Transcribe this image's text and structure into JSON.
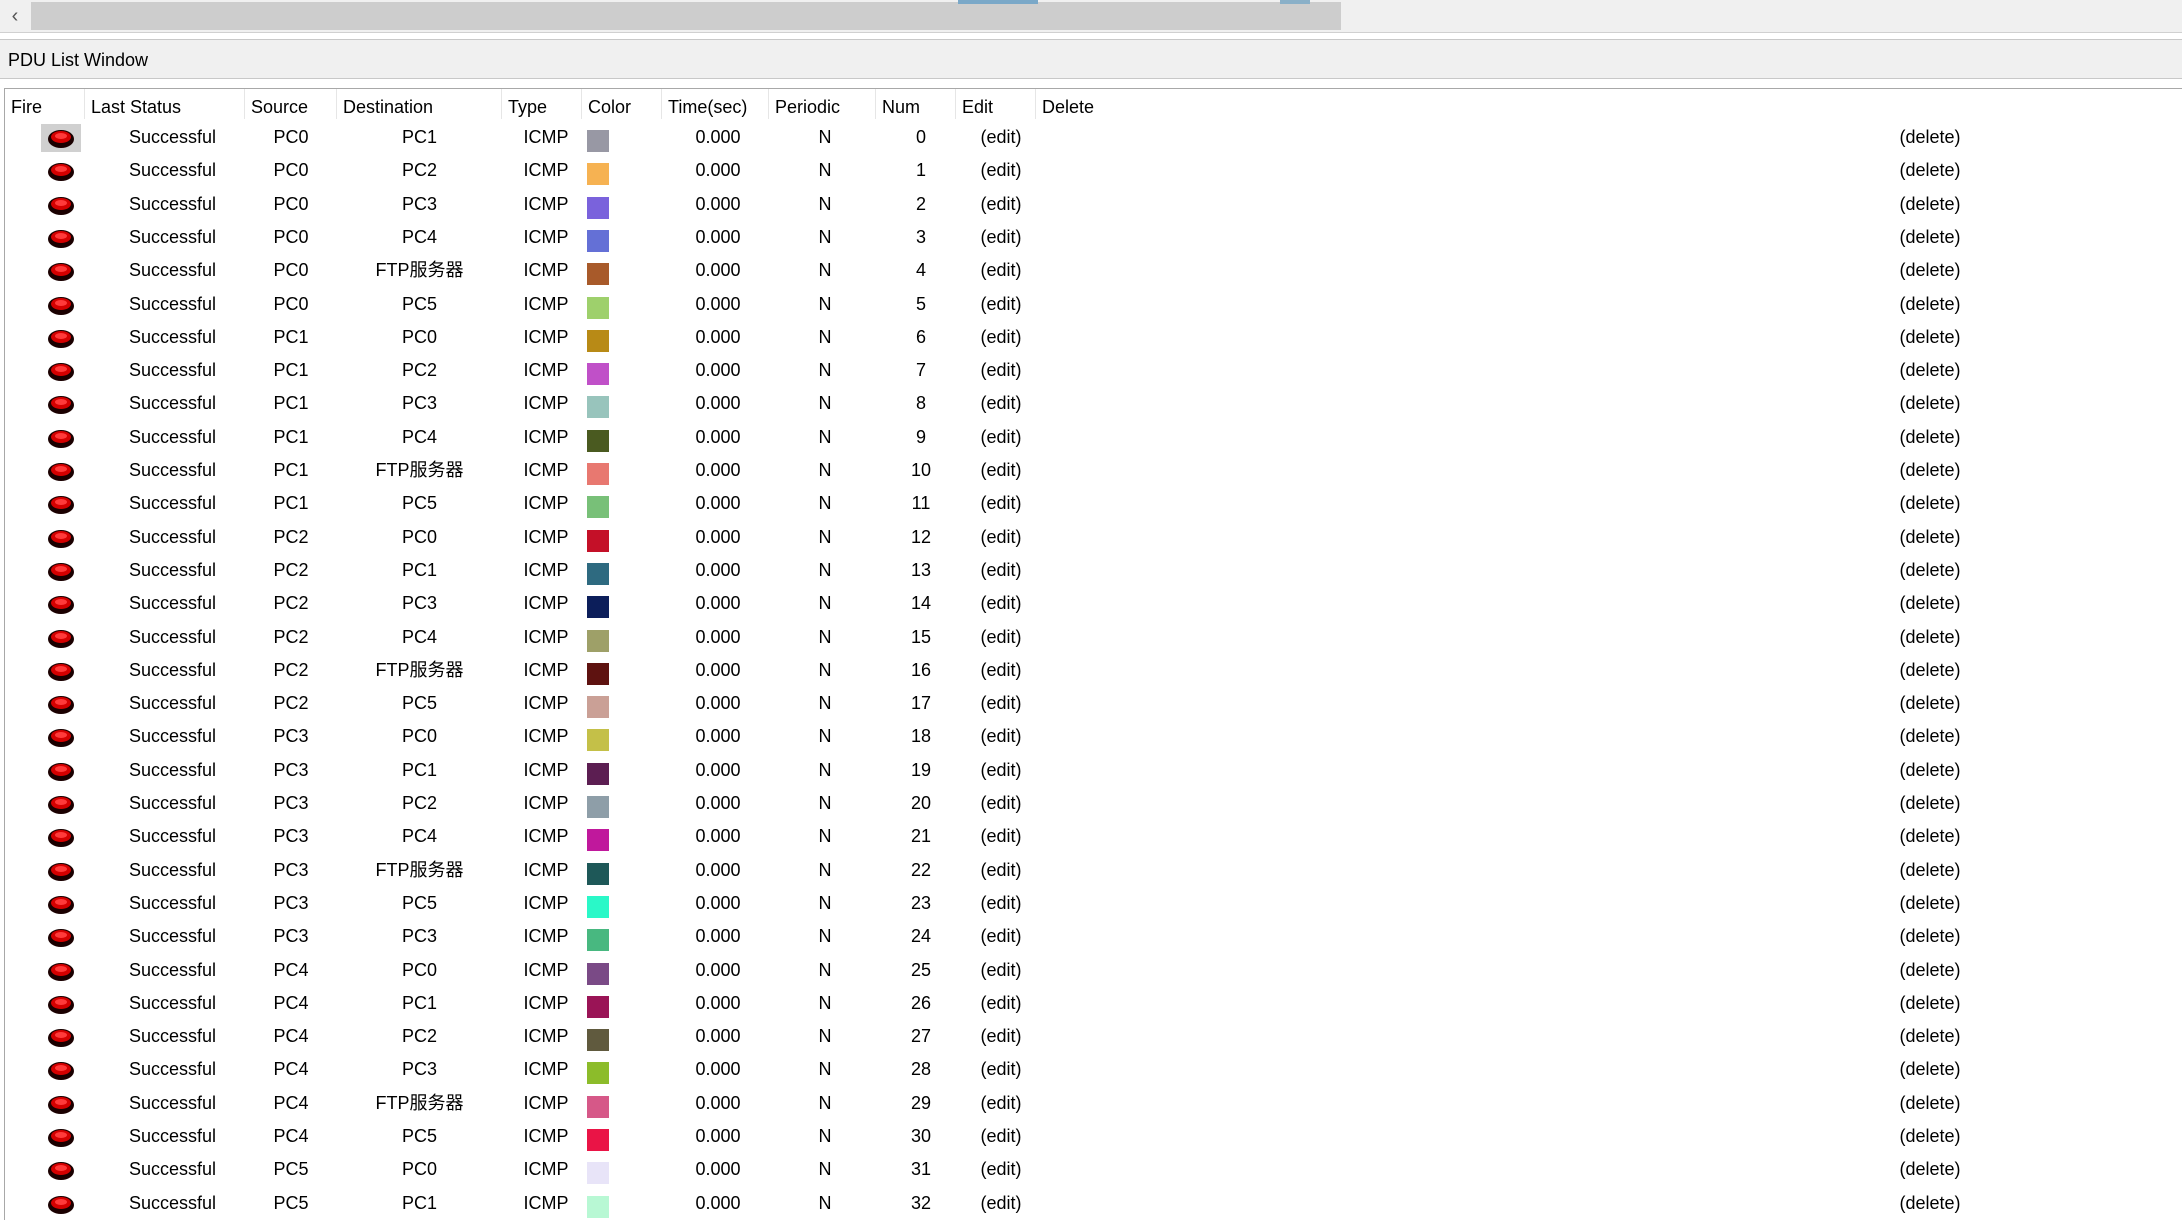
{
  "scrollbar": {
    "left_arrow": "‹"
  },
  "window": {
    "title": "PDU List Window"
  },
  "columns": [
    "Fire",
    "Last Status",
    "Source",
    "Destination",
    "Type",
    "Color",
    "Time(sec)",
    "Periodic",
    "Num",
    "Edit",
    "Delete"
  ],
  "icons": {
    "fire": "fire-ball-icon"
  },
  "rows": [
    {
      "status": "Successful",
      "source": "PC0",
      "destination": "PC1",
      "type": "ICMP",
      "color": "#9898a4",
      "time": "0.000",
      "periodic": "N",
      "num": "0",
      "edit": "(edit)",
      "delete": "(delete)"
    },
    {
      "status": "Successful",
      "source": "PC0",
      "destination": "PC2",
      "type": "ICMP",
      "color": "#f6b252",
      "time": "0.000",
      "periodic": "N",
      "num": "1",
      "edit": "(edit)",
      "delete": "(delete)"
    },
    {
      "status": "Successful",
      "source": "PC0",
      "destination": "PC3",
      "type": "ICMP",
      "color": "#7a62dc",
      "time": "0.000",
      "periodic": "N",
      "num": "2",
      "edit": "(edit)",
      "delete": "(delete)"
    },
    {
      "status": "Successful",
      "source": "PC0",
      "destination": "PC4",
      "type": "ICMP",
      "color": "#6470d6",
      "time": "0.000",
      "periodic": "N",
      "num": "3",
      "edit": "(edit)",
      "delete": "(delete)"
    },
    {
      "status": "Successful",
      "source": "PC0",
      "destination": "FTP服务器",
      "type": "ICMP",
      "color": "#a85a2a",
      "time": "0.000",
      "periodic": "N",
      "num": "4",
      "edit": "(edit)",
      "delete": "(delete)"
    },
    {
      "status": "Successful",
      "source": "PC0",
      "destination": "PC5",
      "type": "ICMP",
      "color": "#9ed06c",
      "time": "0.000",
      "periodic": "N",
      "num": "5",
      "edit": "(edit)",
      "delete": "(delete)"
    },
    {
      "status": "Successful",
      "source": "PC1",
      "destination": "PC0",
      "type": "ICMP",
      "color": "#b88a16",
      "time": "0.000",
      "periodic": "N",
      "num": "6",
      "edit": "(edit)",
      "delete": "(delete)"
    },
    {
      "status": "Successful",
      "source": "PC1",
      "destination": "PC2",
      "type": "ICMP",
      "color": "#c050c8",
      "time": "0.000",
      "periodic": "N",
      "num": "7",
      "edit": "(edit)",
      "delete": "(delete)"
    },
    {
      "status": "Successful",
      "source": "PC1",
      "destination": "PC3",
      "type": "ICMP",
      "color": "#98c4bc",
      "time": "0.000",
      "periodic": "N",
      "num": "8",
      "edit": "(edit)",
      "delete": "(delete)"
    },
    {
      "status": "Successful",
      "source": "PC1",
      "destination": "PC4",
      "type": "ICMP",
      "color": "#4a5a20",
      "time": "0.000",
      "periodic": "N",
      "num": "9",
      "edit": "(edit)",
      "delete": "(delete)"
    },
    {
      "status": "Successful",
      "source": "PC1",
      "destination": "FTP服务器",
      "type": "ICMP",
      "color": "#e87870",
      "time": "0.000",
      "periodic": "N",
      "num": "10",
      "edit": "(edit)",
      "delete": "(delete)"
    },
    {
      "status": "Successful",
      "source": "PC1",
      "destination": "PC5",
      "type": "ICMP",
      "color": "#78c078",
      "time": "0.000",
      "periodic": "N",
      "num": "11",
      "edit": "(edit)",
      "delete": "(delete)"
    },
    {
      "status": "Successful",
      "source": "PC2",
      "destination": "PC0",
      "type": "ICMP",
      "color": "#c41028",
      "time": "0.000",
      "periodic": "N",
      "num": "12",
      "edit": "(edit)",
      "delete": "(delete)"
    },
    {
      "status": "Successful",
      "source": "PC2",
      "destination": "PC1",
      "type": "ICMP",
      "color": "#2e6a80",
      "time": "0.000",
      "periodic": "N",
      "num": "13",
      "edit": "(edit)",
      "delete": "(delete)"
    },
    {
      "status": "Successful",
      "source": "PC2",
      "destination": "PC3",
      "type": "ICMP",
      "color": "#0c1e5a",
      "time": "0.000",
      "periodic": "N",
      "num": "14",
      "edit": "(edit)",
      "delete": "(delete)"
    },
    {
      "status": "Successful",
      "source": "PC2",
      "destination": "PC4",
      "type": "ICMP",
      "color": "#9ea068",
      "time": "0.000",
      "periodic": "N",
      "num": "15",
      "edit": "(edit)",
      "delete": "(delete)"
    },
    {
      "status": "Successful",
      "source": "PC2",
      "destination": "FTP服务器",
      "type": "ICMP",
      "color": "#5e1210",
      "time": "0.000",
      "periodic": "N",
      "num": "16",
      "edit": "(edit)",
      "delete": "(delete)"
    },
    {
      "status": "Successful",
      "source": "PC2",
      "destination": "PC5",
      "type": "ICMP",
      "color": "#caa096",
      "time": "0.000",
      "periodic": "N",
      "num": "17",
      "edit": "(edit)",
      "delete": "(delete)"
    },
    {
      "status": "Successful",
      "source": "PC3",
      "destination": "PC0",
      "type": "ICMP",
      "color": "#c4c048",
      "time": "0.000",
      "periodic": "N",
      "num": "18",
      "edit": "(edit)",
      "delete": "(delete)"
    },
    {
      "status": "Successful",
      "source": "PC3",
      "destination": "PC1",
      "type": "ICMP",
      "color": "#5c1e52",
      "time": "0.000",
      "periodic": "N",
      "num": "19",
      "edit": "(edit)",
      "delete": "(delete)"
    },
    {
      "status": "Successful",
      "source": "PC3",
      "destination": "PC2",
      "type": "ICMP",
      "color": "#8e9ea8",
      "time": "0.000",
      "periodic": "N",
      "num": "20",
      "edit": "(edit)",
      "delete": "(delete)"
    },
    {
      "status": "Successful",
      "source": "PC3",
      "destination": "PC4",
      "type": "ICMP",
      "color": "#c0189c",
      "time": "0.000",
      "periodic": "N",
      "num": "21",
      "edit": "(edit)",
      "delete": "(delete)"
    },
    {
      "status": "Successful",
      "source": "PC3",
      "destination": "FTP服务器",
      "type": "ICMP",
      "color": "#1e5858",
      "time": "0.000",
      "periodic": "N",
      "num": "22",
      "edit": "(edit)",
      "delete": "(delete)"
    },
    {
      "status": "Successful",
      "source": "PC3",
      "destination": "PC5",
      "type": "ICMP",
      "color": "#2af8c8",
      "time": "0.000",
      "periodic": "N",
      "num": "23",
      "edit": "(edit)",
      "delete": "(delete)"
    },
    {
      "status": "Successful",
      "source": "PC3",
      "destination": "PC3",
      "type": "ICMP",
      "color": "#48b880",
      "time": "0.000",
      "periodic": "N",
      "num": "24",
      "edit": "(edit)",
      "delete": "(delete)"
    },
    {
      "status": "Successful",
      "source": "PC4",
      "destination": "PC0",
      "type": "ICMP",
      "color": "#7a4a86",
      "time": "0.000",
      "periodic": "N",
      "num": "25",
      "edit": "(edit)",
      "delete": "(delete)"
    },
    {
      "status": "Successful",
      "source": "PC4",
      "destination": "PC1",
      "type": "ICMP",
      "color": "#9a1456",
      "time": "0.000",
      "periodic": "N",
      "num": "26",
      "edit": "(edit)",
      "delete": "(delete)"
    },
    {
      "status": "Successful",
      "source": "PC4",
      "destination": "PC2",
      "type": "ICMP",
      "color": "#605a3e",
      "time": "0.000",
      "periodic": "N",
      "num": "27",
      "edit": "(edit)",
      "delete": "(delete)"
    },
    {
      "status": "Successful",
      "source": "PC4",
      "destination": "PC3",
      "type": "ICMP",
      "color": "#8cbc2a",
      "time": "0.000",
      "periodic": "N",
      "num": "28",
      "edit": "(edit)",
      "delete": "(delete)"
    },
    {
      "status": "Successful",
      "source": "PC4",
      "destination": "FTP服务器",
      "type": "ICMP",
      "color": "#d65888",
      "time": "0.000",
      "periodic": "N",
      "num": "29",
      "edit": "(edit)",
      "delete": "(delete)"
    },
    {
      "status": "Successful",
      "source": "PC4",
      "destination": "PC5",
      "type": "ICMP",
      "color": "#ea1446",
      "time": "0.000",
      "periodic": "N",
      "num": "30",
      "edit": "(edit)",
      "delete": "(delete)"
    },
    {
      "status": "Successful",
      "source": "PC5",
      "destination": "PC0",
      "type": "ICMP",
      "color": "#e8e4f8",
      "time": "0.000",
      "periodic": "N",
      "num": "31",
      "edit": "(edit)",
      "delete": "(delete)"
    },
    {
      "status": "Successful",
      "source": "PC5",
      "destination": "PC1",
      "type": "ICMP",
      "color": "#b8f8d4",
      "time": "0.000",
      "periodic": "N",
      "num": "32",
      "edit": "(edit)",
      "delete": "(delete)"
    }
  ]
}
